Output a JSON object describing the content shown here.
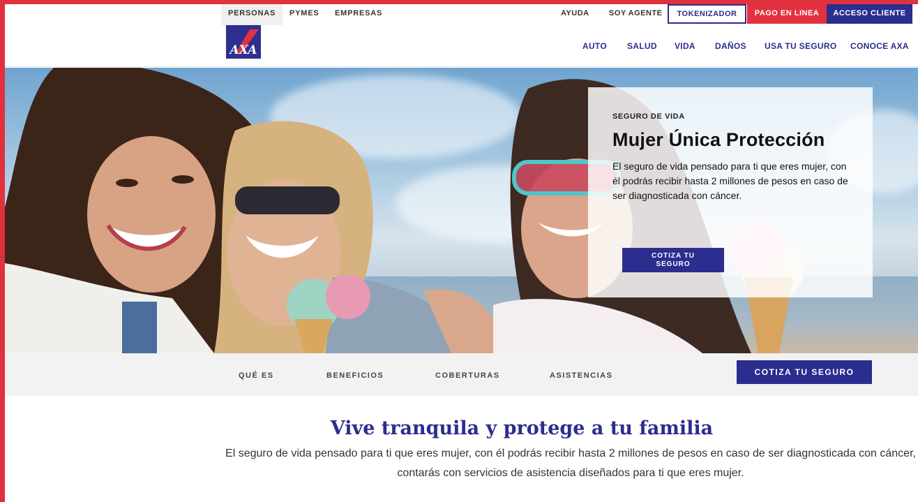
{
  "colors": {
    "brand_blue": "#2b2d8f",
    "brand_red": "#e3313f",
    "frame_red": "#e0313f"
  },
  "topbar": {
    "segments": [
      "PERSONAS",
      "PYMES",
      "EMPRESAS"
    ],
    "links": {
      "ayuda": "AYUDA",
      "agente": "SOY AGENTE"
    },
    "buttons": {
      "tokenizador": "TOKENIZADOR",
      "pago": "PAGO EN LINEA",
      "acceso": "ACCESO CLIENTE"
    }
  },
  "header": {
    "logo_icon": "axa-logo",
    "nav": [
      "AUTO",
      "SALUD",
      "VIDA",
      "DAÑOS",
      "USA TU SEGURO",
      "CONOCE AXA"
    ]
  },
  "hero": {
    "eyebrow": "SEGURO DE VIDA",
    "title": "Mujer Única Protección",
    "text": "El seguro de vida pensado para ti que eres mujer, con él podrás recibir hasta 2 millones de pesos en caso de ser diagnosticada con cáncer.",
    "cta_line1": "COTIZA TU",
    "cta_line2": "SEGURO"
  },
  "subnav": {
    "items": [
      "QUÉ ES",
      "BENEFICIOS",
      "COBERTURAS",
      "ASISTENCIAS"
    ],
    "cta": "COTIZA TU SEGURO"
  },
  "intro": {
    "title": "Vive tranquila y protege a tu familia",
    "text": "El seguro de vida pensado para ti que eres mujer, con él podrás recibir hasta 2 millones de pesos en caso de ser diagnosticada con cáncer, contarás con servicios de asistencia diseñados para ti que eres mujer."
  }
}
